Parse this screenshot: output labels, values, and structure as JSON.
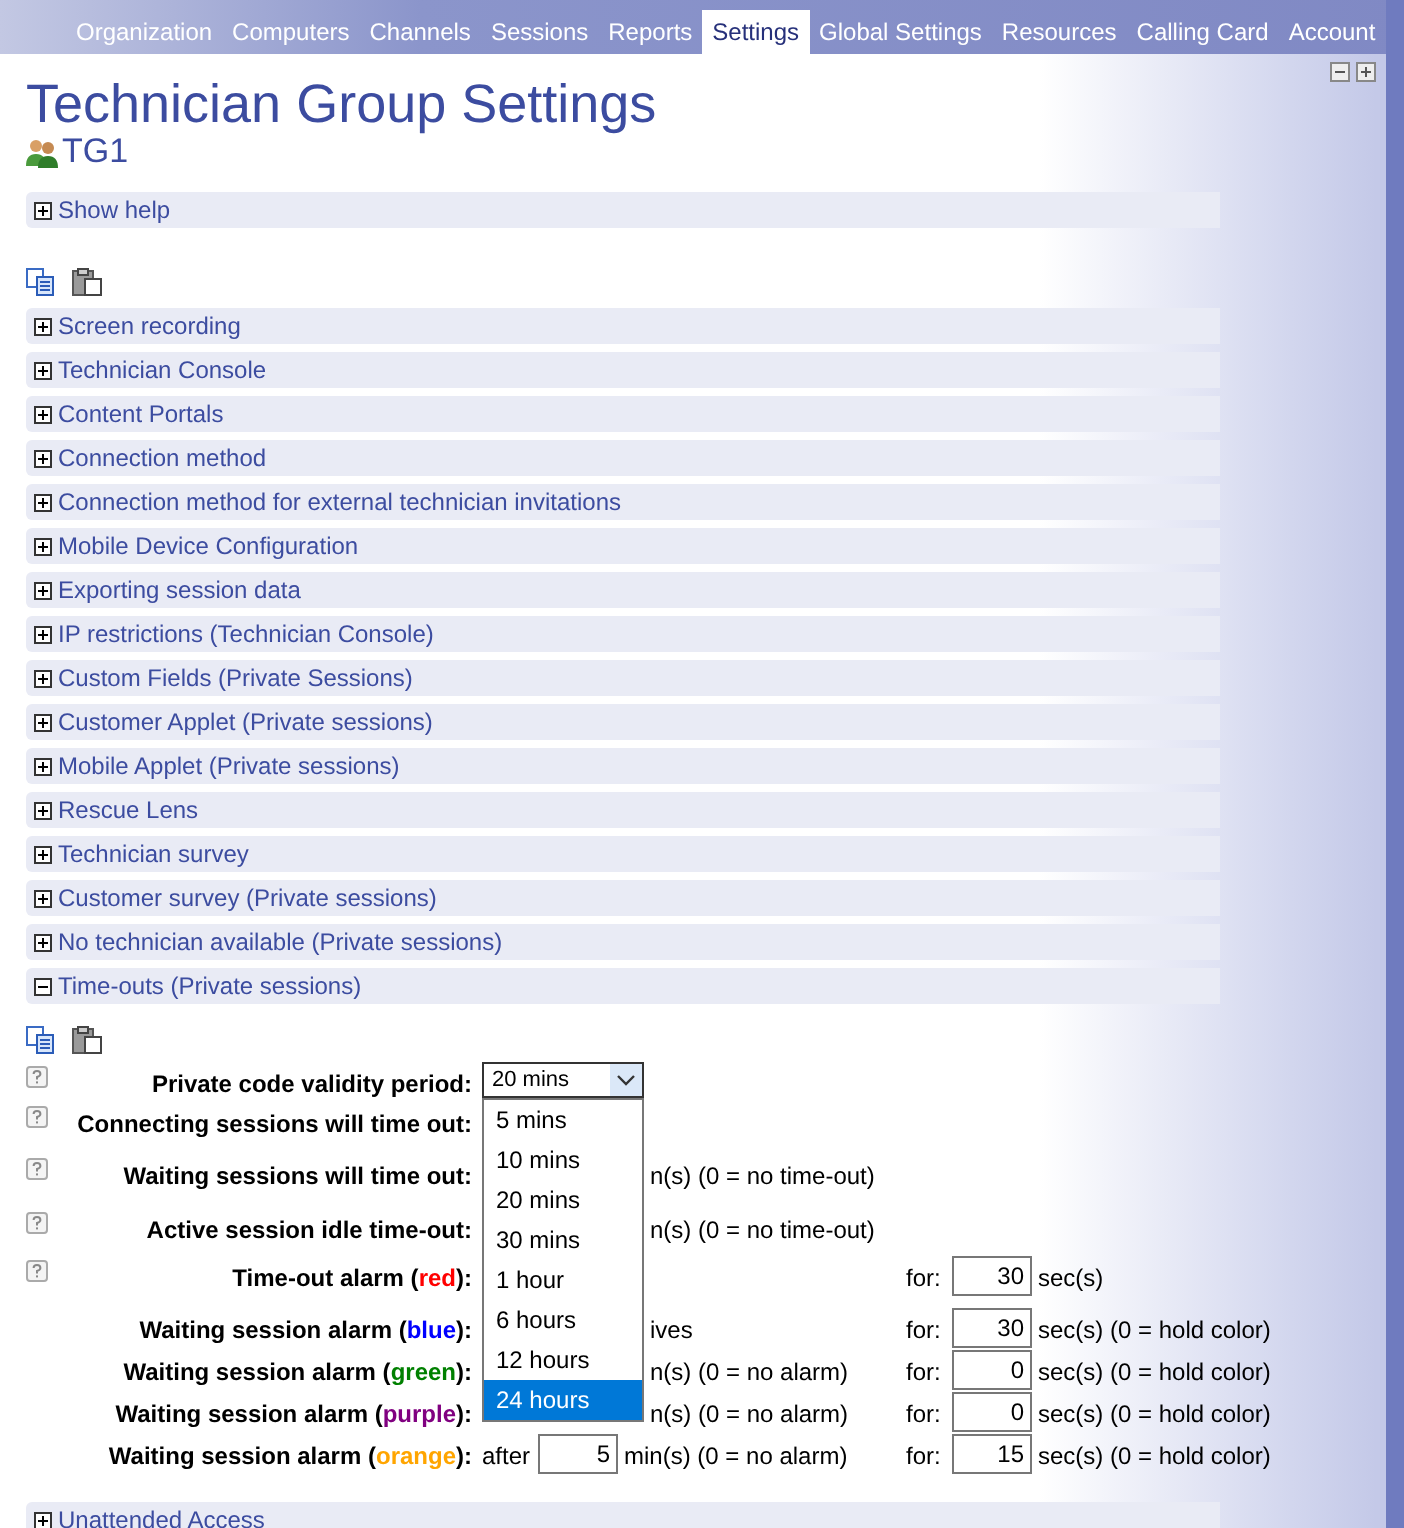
{
  "nav_tabs": [
    {
      "label": "Organization",
      "selected": false
    },
    {
      "label": "Computers",
      "selected": false
    },
    {
      "label": "Channels",
      "selected": false
    },
    {
      "label": "Sessions",
      "selected": false
    },
    {
      "label": "Reports",
      "selected": false
    },
    {
      "label": "Settings",
      "selected": true
    },
    {
      "label": "Global Settings",
      "selected": false
    },
    {
      "label": "Resources",
      "selected": false
    },
    {
      "label": "Calling Card",
      "selected": false
    },
    {
      "label": "Account",
      "selected": false
    }
  ],
  "page_title": "Technician Group Settings",
  "group_name": "TG1",
  "help_section": {
    "label": "Show help",
    "expanded": false
  },
  "sections": [
    {
      "label": "Screen recording",
      "expanded": false
    },
    {
      "label": "Technician Console",
      "expanded": false
    },
    {
      "label": "Content Portals",
      "expanded": false
    },
    {
      "label": "Connection method",
      "expanded": false
    },
    {
      "label": "Connection method for external technician invitations",
      "expanded": false
    },
    {
      "label": "Mobile Device Configuration",
      "expanded": false
    },
    {
      "label": "Exporting session data",
      "expanded": false
    },
    {
      "label": "IP restrictions (Technician Console)",
      "expanded": false
    },
    {
      "label": "Custom Fields (Private Sessions)",
      "expanded": false
    },
    {
      "label": "Customer Applet (Private sessions)",
      "expanded": false
    },
    {
      "label": "Mobile Applet (Private sessions)",
      "expanded": false
    },
    {
      "label": "Rescue Lens",
      "expanded": false
    },
    {
      "label": "Technician survey",
      "expanded": false
    },
    {
      "label": "Customer survey (Private sessions)",
      "expanded": false
    },
    {
      "label": "No technician available (Private sessions)",
      "expanded": false
    },
    {
      "label": "Time-outs (Private sessions)",
      "expanded": true
    }
  ],
  "timeout_form": {
    "select": {
      "value": "20 mins",
      "expanded": true,
      "options": [
        {
          "label": "5 mins",
          "highlighted": false
        },
        {
          "label": "10 mins",
          "highlighted": false
        },
        {
          "label": "20 mins",
          "highlighted": false
        },
        {
          "label": "30 mins",
          "highlighted": false
        },
        {
          "label": "1 hour",
          "highlighted": false
        },
        {
          "label": "6 hours",
          "highlighted": false
        },
        {
          "label": "12 hours",
          "highlighted": false
        },
        {
          "label": "24 hours",
          "highlighted": true
        }
      ]
    },
    "rows": [
      {
        "kind": "select",
        "help": true,
        "label": "Private code validity period:"
      },
      {
        "kind": "plain",
        "help": true,
        "label": "Connecting sessions will time out:"
      },
      {
        "kind": "plain",
        "help": true,
        "label": "Waiting sessions will time out:",
        "middle": "n(s)  (0 = no time-out)"
      },
      {
        "kind": "plain",
        "help": true,
        "label": "Active session idle time-out:",
        "middle": "n(s)  (0 = no time-out)"
      },
      {
        "kind": "alarm",
        "help": true,
        "label_before": "Time-out alarm (",
        "label_word": "red",
        "label_after": "):",
        "color": "#ff0000",
        "for_label": "for:",
        "for_value": "30",
        "suffix": "sec(s)"
      },
      {
        "kind": "alarm",
        "help": false,
        "label_before": "Waiting session alarm (",
        "label_word": "blue",
        "label_after": "):",
        "color": "#0000ff",
        "middle": "ives",
        "for_label": "for:",
        "for_value": "30",
        "suffix": "sec(s) (0 = hold color)"
      },
      {
        "kind": "alarm",
        "help": false,
        "label_before": "Waiting session alarm (",
        "label_word": "green",
        "label_after": "):",
        "color": "#008000",
        "middle": "n(s)  (0 = no alarm)",
        "for_label": "for:",
        "for_value": "0",
        "suffix": "sec(s) (0 = hold color)"
      },
      {
        "kind": "alarm",
        "help": false,
        "label_before": "Waiting session alarm (",
        "label_word": "purple",
        "label_after": "):",
        "color": "#800080",
        "middle": "n(s)  (0 = no alarm)",
        "for_label": "for:",
        "for_value": "0",
        "suffix": "sec(s) (0 = hold color)"
      },
      {
        "kind": "after",
        "help": false,
        "label_before": "Waiting session alarm (",
        "label_word": "orange",
        "label_after": "):",
        "color": "#ffa500",
        "after_label": "after",
        "after_value": "5",
        "middle": "min(s)  (0 = no alarm)",
        "for_label": "for:",
        "for_value": "15",
        "suffix": "sec(s) (0 = hold color)"
      }
    ]
  },
  "bottom_section": {
    "label": "Unattended Access",
    "expanded": false
  }
}
